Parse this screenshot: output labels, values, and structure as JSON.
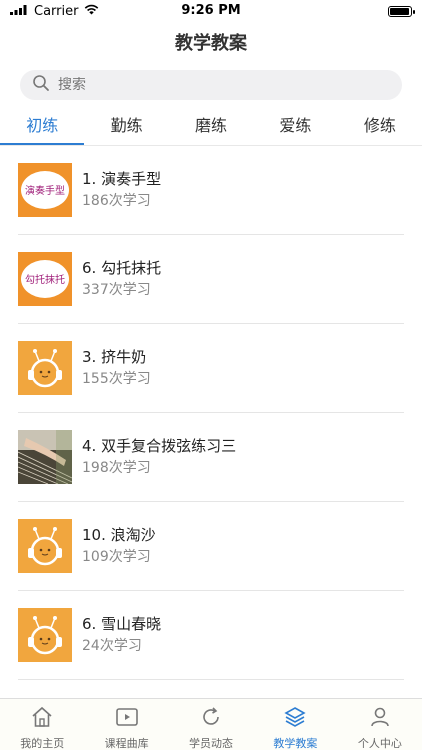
{
  "status": {
    "carrier": "Carrier",
    "time": "9:26 PM",
    "battery_level": 0.95
  },
  "nav": {
    "title": "教学教案"
  },
  "search": {
    "placeholder": "搜索"
  },
  "tabs": [
    {
      "label": "初练",
      "active": true
    },
    {
      "label": "勤练",
      "active": false
    },
    {
      "label": "磨练",
      "active": false
    },
    {
      "label": "爱练",
      "active": false
    },
    {
      "label": "修练",
      "active": false
    }
  ],
  "lessons": [
    {
      "title": "1. 演奏手型",
      "count": "186次学习",
      "thumb": "orange-label-thumbnail",
      "thumb_text": "演奏手型"
    },
    {
      "title": "6. 勾托抹托",
      "count": "337次学习",
      "thumb": "orange-label-thumbnail",
      "thumb_text": "勾托抹托"
    },
    {
      "title": "3. 挤牛奶",
      "count": "155次学习",
      "thumb": "mascot-placeholder"
    },
    {
      "title": "4. 双手复合拨弦练习三",
      "count": "198次学习",
      "thumb": "guzheng-photo"
    },
    {
      "title": "10. 浪淘沙",
      "count": "109次学习",
      "thumb": "mascot-placeholder"
    },
    {
      "title": "6. 雪山春晓",
      "count": "24次学习",
      "thumb": "mascot-placeholder"
    }
  ],
  "tabbar": [
    {
      "label": "我的主页",
      "icon": "home-icon",
      "active": false
    },
    {
      "label": "课程曲库",
      "icon": "video-icon",
      "active": false
    },
    {
      "label": "学员动态",
      "icon": "refresh-icon",
      "active": false
    },
    {
      "label": "教学教案",
      "icon": "layers-icon",
      "active": true
    },
    {
      "label": "个人中心",
      "icon": "person-icon",
      "active": false
    }
  ],
  "colors": {
    "accent": "#2d7dd2",
    "thumb_orange": "#f0922a",
    "mascot_bg": "#f1a63e"
  }
}
